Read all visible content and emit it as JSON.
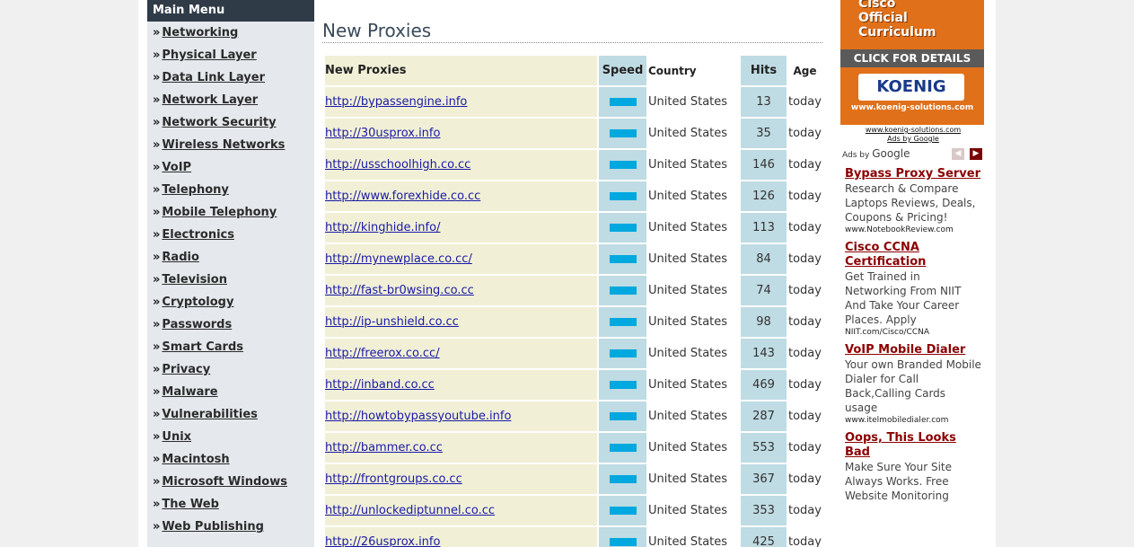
{
  "sidebar": {
    "header": "Main Menu",
    "arrow": "»",
    "items": [
      {
        "label": "Networking"
      },
      {
        "label": "Physical Layer"
      },
      {
        "label": "Data Link Layer"
      },
      {
        "label": "Network Layer"
      },
      {
        "label": "Network Security"
      },
      {
        "label": "Wireless Networks"
      },
      {
        "label": "VoIP"
      },
      {
        "label": "Telephony"
      },
      {
        "label": "Mobile Telephony"
      },
      {
        "label": "Electronics"
      },
      {
        "label": "Radio"
      },
      {
        "label": "Television"
      },
      {
        "label": "Cryptology"
      },
      {
        "label": "Passwords"
      },
      {
        "label": "Smart Cards"
      },
      {
        "label": "Privacy"
      },
      {
        "label": "Malware"
      },
      {
        "label": "Vulnerabilities"
      },
      {
        "label": "Unix"
      },
      {
        "label": "Macintosh"
      },
      {
        "label": "Microsoft Windows"
      },
      {
        "label": "The Web"
      },
      {
        "label": "Web Publishing"
      }
    ]
  },
  "main": {
    "title": "New Proxies",
    "table": {
      "headers": {
        "url": "New Proxies",
        "speed": "Speed",
        "country": "Country",
        "hits": "Hits",
        "age": "Age"
      },
      "rows": [
        {
          "url": "http://bypassengine.info",
          "country": "United States",
          "hits": "13",
          "age": "today"
        },
        {
          "url": "http://30usprox.info",
          "country": "United States",
          "hits": "35",
          "age": "today"
        },
        {
          "url": "http://usschoolhigh.co.cc",
          "country": "United States",
          "hits": "146",
          "age": "today"
        },
        {
          "url": "http://www.forexhide.co.cc",
          "country": "United States",
          "hits": "126",
          "age": "today"
        },
        {
          "url": "http://kinghide.info/",
          "country": "United States",
          "hits": "113",
          "age": "today"
        },
        {
          "url": "http://mynewplace.co.cc/",
          "country": "United States",
          "hits": "84",
          "age": "today"
        },
        {
          "url": "http://fast-br0wsing.co.cc",
          "country": "United States",
          "hits": "74",
          "age": "today"
        },
        {
          "url": "http://ip-unshield.co.cc",
          "country": "United States",
          "hits": "98",
          "age": "today"
        },
        {
          "url": "http://freerox.co.cc/",
          "country": "United States",
          "hits": "143",
          "age": "today"
        },
        {
          "url": "http://inband.co.cc",
          "country": "United States",
          "hits": "469",
          "age": "today"
        },
        {
          "url": "http://howtobypassyoutube.info",
          "country": "United States",
          "hits": "287",
          "age": "today"
        },
        {
          "url": "http://bammer.co.cc",
          "country": "United States",
          "hits": "553",
          "age": "today"
        },
        {
          "url": "http://frontgroups.co.cc",
          "country": "United States",
          "hits": "367",
          "age": "today"
        },
        {
          "url": "http://unlockediptunnel.co.cc",
          "country": "United States",
          "hits": "353",
          "age": "today"
        },
        {
          "url": "http://26usprox.info",
          "country": "United States",
          "hits": "425",
          "age": "today"
        }
      ]
    }
  },
  "ads": {
    "banner": {
      "title_line1": "Cisco",
      "title_line2": "Official",
      "title_line3": "Curriculum",
      "click": "CLICK FOR DETAILS",
      "logo": "KOENIG",
      "site": "www.koenig-solutions.com",
      "foot_url": "www.koenig-solutions.com",
      "foot_ads": "Ads by Google"
    },
    "adsby_prefix": "Ads by",
    "adsby_brand": "Google",
    "prev": "◀",
    "next": "▶",
    "items": [
      {
        "title": "Bypass Proxy Server",
        "text": "Research & Compare Laptops Reviews, Deals, Coupons & Pricing!",
        "url": "www.NotebookReview.com"
      },
      {
        "title": "Cisco CCNA Certification",
        "text": "Get Trained in Networking From NIIT And Take Your Career Places. Apply",
        "url": "NIIT.com/Cisco/CCNA"
      },
      {
        "title": "VoIP Mobile Dialer",
        "text": "Your own Branded Mobile Dialer for Call Back,Calling Cards usage",
        "url": "www.itelmobiledialer.com"
      },
      {
        "title": "Oops, This Looks Bad",
        "text": "Make Sure Your Site Always Works. Free Website Monitoring",
        "url": ""
      }
    ]
  },
  "colors": {
    "sidebar_header": "#2f3b47",
    "sidebar_bg": "#e5e8ec",
    "url_cell": "#f1f0d6",
    "speed_cell": "#bfdbe3",
    "speed_bar": "#00a8e0",
    "ad_title": "#8b0000",
    "banner": "#e0701a"
  }
}
